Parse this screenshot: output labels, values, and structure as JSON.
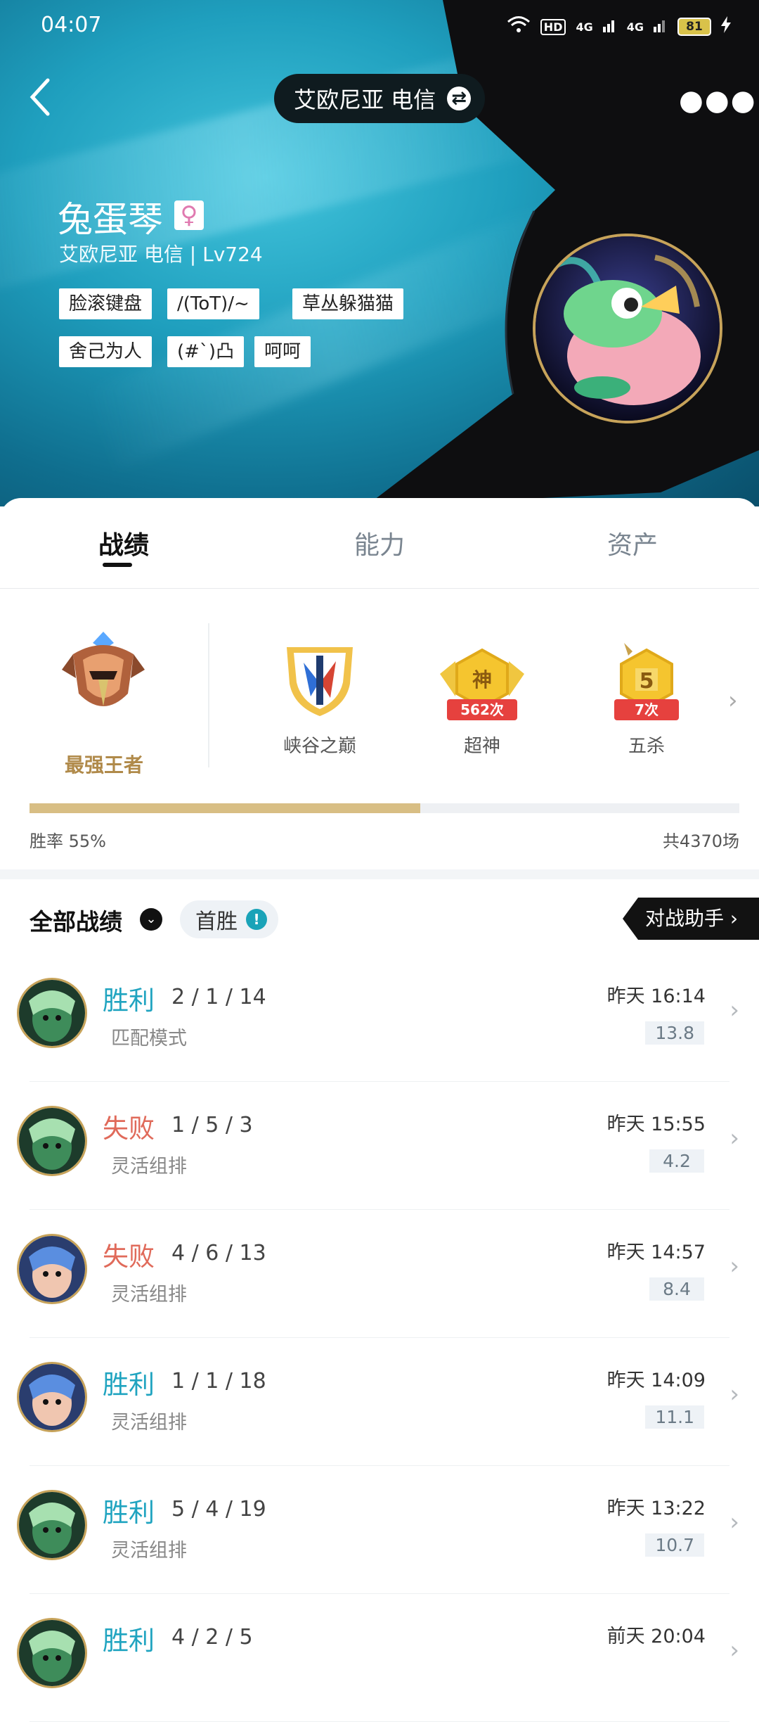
{
  "status_bar": {
    "time": "04:07",
    "battery": "81",
    "hd": "HD",
    "net1": "4G",
    "net2": "4G"
  },
  "header": {
    "server": "艾欧尼亚 电信",
    "username": "兔蛋琴",
    "subline": "艾欧尼亚 电信 | Lv724",
    "tags": [
      "脸滚键盘",
      "/(ToT)/~",
      "草丛躲猫猫",
      "舍己为人",
      "(#`)凸",
      "呵呵"
    ]
  },
  "tabs": [
    "战绩",
    "能力",
    "资产"
  ],
  "rank": {
    "name": "最强王者"
  },
  "honors": [
    {
      "label": "峡谷之巅",
      "badge": ""
    },
    {
      "label": "超神",
      "badge": "562次",
      "glyph": "神"
    },
    {
      "label": "五杀",
      "badge": "7次",
      "glyph": "5"
    }
  ],
  "stats": {
    "win_rate_label": "胜率  55%",
    "win_rate": 0.55,
    "total": "共4370场"
  },
  "records_header": {
    "title": "全部战绩",
    "first_win": "首胜",
    "assistant": "对战助手"
  },
  "matches": [
    {
      "result": "胜利",
      "kda": "2 / 1 / 14",
      "mode": "匹配模式",
      "time": "昨天 16:14",
      "score": "13.8",
      "win": true
    },
    {
      "result": "失败",
      "kda": "1 / 5 / 3",
      "mode": "灵活组排",
      "time": "昨天 15:55",
      "score": "4.2",
      "win": false
    },
    {
      "result": "失败",
      "kda": "4 / 6 / 13",
      "mode": "灵活组排",
      "time": "昨天 14:57",
      "score": "8.4",
      "win": false
    },
    {
      "result": "胜利",
      "kda": "1 / 1 / 18",
      "mode": "灵活组排",
      "time": "昨天 14:09",
      "score": "11.1",
      "win": true
    },
    {
      "result": "胜利",
      "kda": "5 / 4 / 19",
      "mode": "灵活组排",
      "time": "昨天 13:22",
      "score": "10.7",
      "win": true
    },
    {
      "result": "胜利",
      "kda": "4 / 2 / 5",
      "mode": "",
      "time": "前天 20:04",
      "score": "",
      "win": true
    }
  ],
  "colors": {
    "win": "#20a4c0",
    "lose": "#e06a5a",
    "gold": "#c7a35a"
  }
}
